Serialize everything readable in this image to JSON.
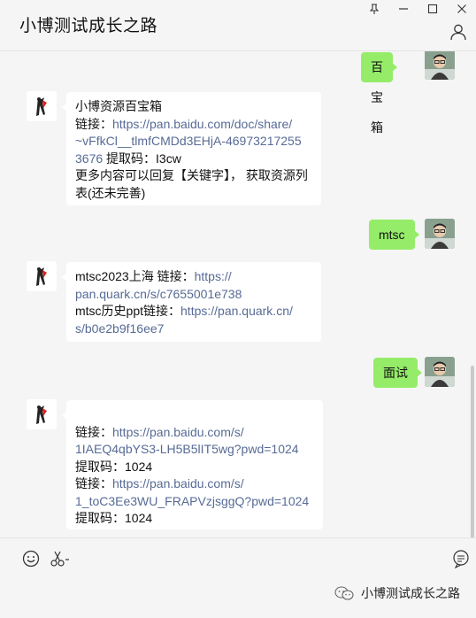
{
  "window": {
    "title": "小博测试成长之路",
    "controls": {
      "pin": "⊥",
      "minimize": "—",
      "maximize": "□",
      "close": "✕"
    }
  },
  "messages": [
    {
      "from": "self",
      "text": "百宝箱"
    },
    {
      "from": "bot",
      "lines": [
        {
          "parts": [
            {
              "t": "小博资源百宝箱"
            }
          ]
        },
        {
          "parts": [
            {
              "t": "链接："
            },
            {
              "t": "https://pan.baidu.com/doc/share/",
              "link": true
            }
          ]
        },
        {
          "parts": [
            {
              "t": "~vFfkCl__tlmfCMDd3EHjA-46973217255",
              "link": true
            }
          ]
        },
        {
          "parts": [
            {
              "t": "3676",
              "link": true
            },
            {
              "t": " 提取码：I3cw"
            }
          ]
        },
        {
          "parts": [
            {
              "t": "更多内容可以回复【关键字】， 获取资源列"
            }
          ]
        },
        {
          "parts": [
            {
              "t": "表(还未完善)"
            }
          ]
        }
      ]
    },
    {
      "from": "self",
      "text": "mtsc"
    },
    {
      "from": "bot",
      "lines": [
        {
          "parts": [
            {
              "t": "mtsc2023上海  链接："
            },
            {
              "t": "https://",
              "link": true
            }
          ]
        },
        {
          "parts": [
            {
              "t": "pan.quark.cn/s/c7655001e738",
              "link": true
            }
          ]
        },
        {
          "parts": [
            {
              "t": "mtsc历史ppt链接："
            },
            {
              "t": "https://pan.quark.cn/",
              "link": true
            }
          ]
        },
        {
          "parts": [
            {
              "t": "s/b0e2b9f16ee7",
              "link": true
            }
          ]
        }
      ]
    },
    {
      "from": "self",
      "text": "面试"
    },
    {
      "from": "bot",
      "lines": [
        {
          "parts": [
            {
              "t": ""
            }
          ]
        },
        {
          "parts": [
            {
              "t": "链接："
            },
            {
              "t": "https://pan.baidu.com/s/",
              "link": true
            }
          ]
        },
        {
          "parts": [
            {
              "t": "1IAEQ4qbYS3-LH5B5lIT5wg?pwd=1024",
              "link": true
            }
          ]
        },
        {
          "parts": [
            {
              "t": "提取码：1024"
            }
          ]
        },
        {
          "parts": [
            {
              "t": "链接："
            },
            {
              "t": "https://pan.baidu.com/s/",
              "link": true
            }
          ]
        },
        {
          "parts": [
            {
              "t": "1_toC3Ee3WU_FRAPVzjsggQ?pwd=1024",
              "link": true
            }
          ]
        },
        {
          "parts": [
            {
              "t": "提取码：1024"
            }
          ]
        }
      ]
    }
  ],
  "input_bar": {
    "tools": [
      "emoji-icon",
      "scissors-icon",
      "chat-history-icon"
    ],
    "brand": "小博测试成长之路"
  },
  "colors": {
    "self_bubble": "#95ec69",
    "bot_bubble": "#ffffff",
    "link": "#576b95",
    "background": "#f5f5f5"
  }
}
